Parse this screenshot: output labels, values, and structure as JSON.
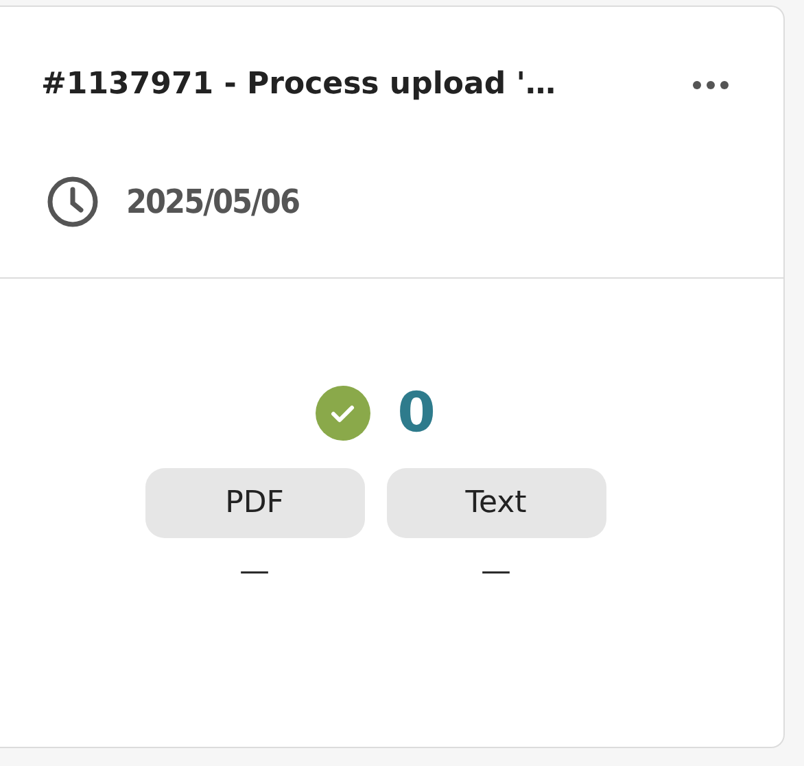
{
  "card": {
    "title": "#1137971 - Process upload '…",
    "date": "2025/05/06",
    "status": {
      "kind": "success",
      "count": "0"
    },
    "formats": [
      {
        "label": "PDF",
        "value": "—"
      },
      {
        "label": "Text",
        "value": "—"
      }
    ]
  }
}
